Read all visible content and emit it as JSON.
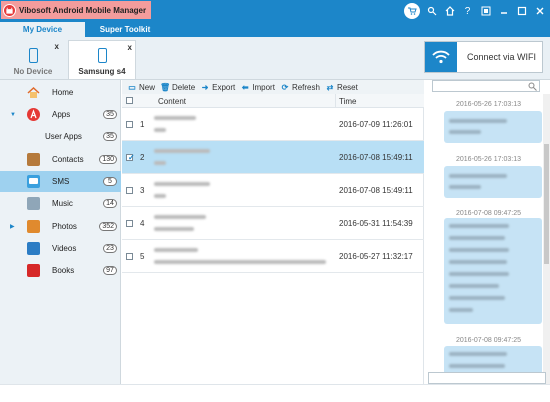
{
  "app": {
    "title": "Vibosoft Android Mobile Manager"
  },
  "colors": {
    "brand": "#1c86c9",
    "badge": "#f39c9c",
    "selected_row": "#b8dff5",
    "bubble": "#c6e3f5"
  },
  "window_icons": [
    "cart-icon",
    "search-icon",
    "home-icon",
    "help-icon",
    "restore-icon",
    "minimize-icon",
    "maximize-icon",
    "close-icon"
  ],
  "menu": {
    "tabs": [
      {
        "label": "My Device",
        "active": true
      },
      {
        "label": "Super Toolkit",
        "active": false
      }
    ]
  },
  "devices": [
    {
      "label": "No Device",
      "active": false,
      "close": "x"
    },
    {
      "label": "Samsung s4",
      "active": true,
      "close": "x"
    }
  ],
  "wifi": {
    "label": "Connect via WIFI"
  },
  "sidebar": {
    "items": [
      {
        "label": "Home",
        "count": "",
        "icon": "home-icon"
      },
      {
        "label": "Apps",
        "count": "35",
        "icon": "apps-icon"
      },
      {
        "label": "User Apps",
        "count": "35",
        "icon": ""
      },
      {
        "label": "Contacts",
        "count": "130",
        "icon": "contacts-icon"
      },
      {
        "label": "SMS",
        "count": "5",
        "icon": "sms-icon"
      },
      {
        "label": "Music",
        "count": "14",
        "icon": "music-icon"
      },
      {
        "label": "Photos",
        "count": "352",
        "icon": "photos-icon"
      },
      {
        "label": "Videos",
        "count": "23",
        "icon": "videos-icon"
      },
      {
        "label": "Books",
        "count": "97",
        "icon": "books-icon"
      }
    ]
  },
  "toolbar": {
    "new": "New",
    "delete": "Delete",
    "export": "Export",
    "import": "Import",
    "refresh": "Refresh",
    "reset": "Reset"
  },
  "table": {
    "headers": {
      "content": "Content",
      "time": "Time"
    },
    "rows": [
      {
        "num": "1",
        "time": "2016-07-09 11:26:01",
        "selected": false
      },
      {
        "num": "2",
        "time": "2016-07-08 15:49:11",
        "selected": true
      },
      {
        "num": "3",
        "time": "2016-07-08 15:49:11",
        "selected": false
      },
      {
        "num": "4",
        "time": "2016-05-31 11:54:39",
        "selected": false
      },
      {
        "num": "5",
        "time": "2016-05-27 11:32:17",
        "selected": false
      }
    ]
  },
  "messages": [
    {
      "time": "2016-05-26 17:03:13"
    },
    {
      "time": "2016-05-26 17:03:13"
    },
    {
      "time": "2016-07-08 09:47:25"
    },
    {
      "time": "2016-07-08 09:47:25"
    }
  ]
}
